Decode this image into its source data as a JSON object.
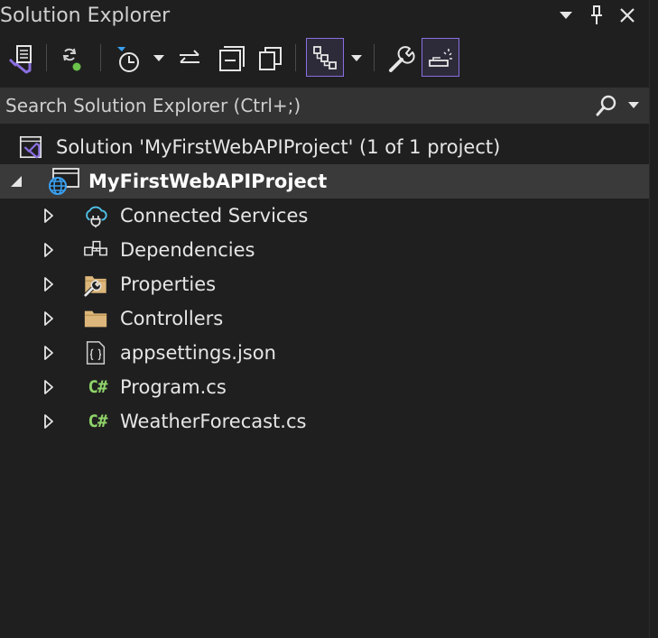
{
  "window": {
    "title": "Solution Explorer",
    "controls": [
      "window-position-menu",
      "pin",
      "close"
    ]
  },
  "toolbar": {
    "buttons": [
      {
        "name": "switch-views-button",
        "icon": "vs-solution-icon"
      },
      {
        "name": "sync-active-document-button",
        "icon": "sync-icon"
      },
      {
        "name": "pending-changes-filter-button",
        "icon": "history-clock-icon",
        "has_dropdown": true
      },
      {
        "name": "sync-with-document-button",
        "icon": "arrows-left-right-icon"
      },
      {
        "name": "collapse-all-button",
        "icon": "collapse-all-icon"
      },
      {
        "name": "show-all-files-button",
        "icon": "copy-pages-icon"
      },
      {
        "name": "show-hierarchy-button",
        "icon": "hierarchy-icon",
        "active": true,
        "has_dropdown": true
      },
      {
        "name": "properties-button",
        "icon": "wrench-icon"
      },
      {
        "name": "preview-selected-items-button",
        "icon": "preview-icon",
        "active": true
      }
    ]
  },
  "search": {
    "placeholder": "Search Solution Explorer (Ctrl+;)",
    "value": ""
  },
  "tree": {
    "solution": {
      "label": "Solution 'MyFirstWebAPIProject' (1 of 1 project)",
      "icon": "vs-solution-icon"
    },
    "project": {
      "label": "MyFirstWebAPIProject",
      "icon": "web-project-globe-icon",
      "expanded": true,
      "selected": true
    },
    "items": [
      {
        "label": "Connected Services",
        "icon": "cloud-plug-icon"
      },
      {
        "label": "Dependencies",
        "icon": "dependencies-icon"
      },
      {
        "label": "Properties",
        "icon": "folder-wrench-icon"
      },
      {
        "label": "Controllers",
        "icon": "folder-icon"
      },
      {
        "label": "appsettings.json",
        "icon": "json-file-icon"
      },
      {
        "label": "Program.cs",
        "icon": "csharp-file-icon",
        "glyph": "C#"
      },
      {
        "label": "WeatherForecast.cs",
        "icon": "csharp-file-icon",
        "glyph": "C#"
      }
    ]
  },
  "colors": {
    "background": "#1f1f1f",
    "selected_row": "#3a3a3a",
    "search_bg": "#333333",
    "accent": "#8a6fe0",
    "csharp": "#8fd36a",
    "folder": "#dcb67a",
    "cloud": "#4fc1e9",
    "globe": "#3aa0f0"
  }
}
